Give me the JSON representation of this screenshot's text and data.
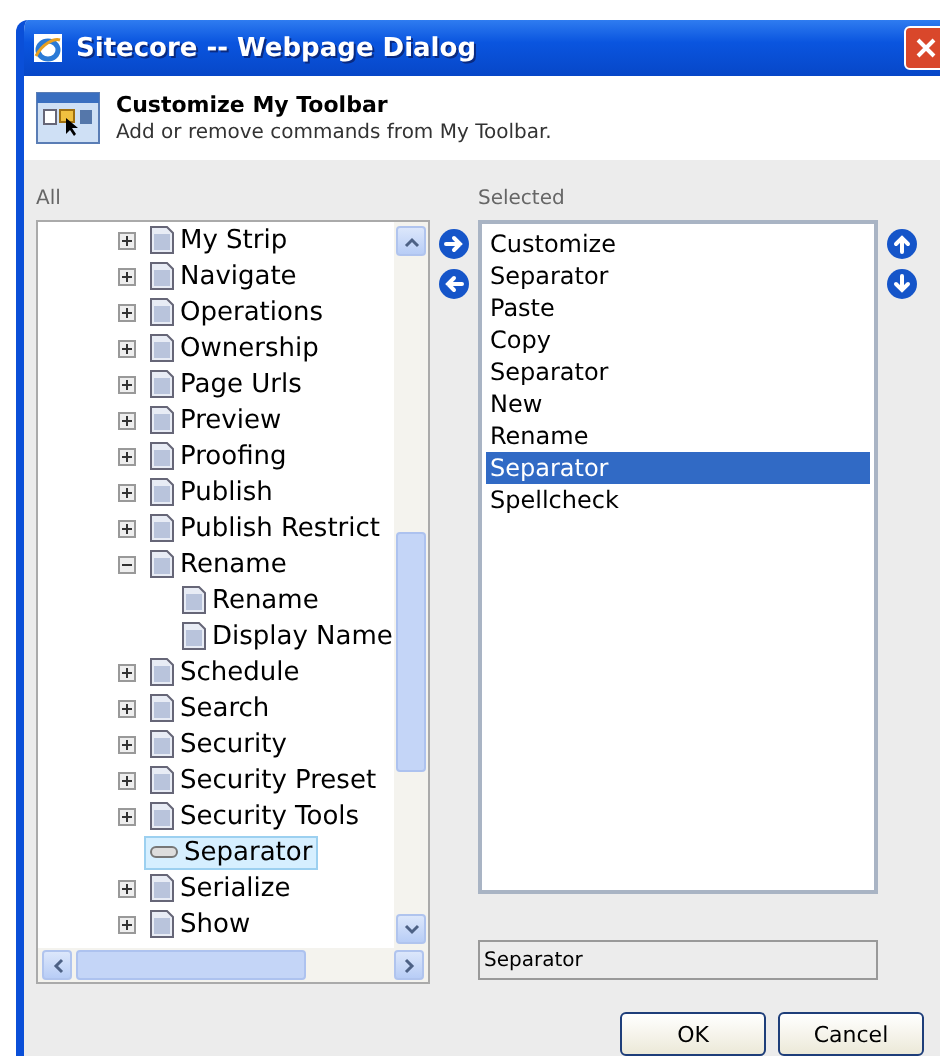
{
  "window": {
    "title": "Sitecore -- Webpage Dialog"
  },
  "header": {
    "title": "Customize My Toolbar",
    "subtitle": "Add or remove commands from My Toolbar."
  },
  "all_label": "All",
  "selected_label": "Selected",
  "tree": [
    {
      "label": "My Strip",
      "kind": "group",
      "expanded": false,
      "selected": false
    },
    {
      "label": "Navigate",
      "kind": "group",
      "expanded": false,
      "selected": false
    },
    {
      "label": "Operations",
      "kind": "group",
      "expanded": false,
      "selected": false
    },
    {
      "label": "Ownership",
      "kind": "group",
      "expanded": false,
      "selected": false
    },
    {
      "label": "Page Urls",
      "kind": "group",
      "expanded": false,
      "selected": false
    },
    {
      "label": "Preview",
      "kind": "group",
      "expanded": false,
      "selected": false
    },
    {
      "label": "Proofing",
      "kind": "group",
      "expanded": false,
      "selected": false
    },
    {
      "label": "Publish",
      "kind": "group",
      "expanded": false,
      "selected": false
    },
    {
      "label": "Publish Restrict",
      "kind": "group",
      "expanded": false,
      "selected": false
    },
    {
      "label": "Rename",
      "kind": "group",
      "expanded": true,
      "selected": false,
      "children": [
        {
          "label": "Rename",
          "kind": "item",
          "selected": false
        },
        {
          "label": "Display Name",
          "kind": "item",
          "selected": false
        }
      ]
    },
    {
      "label": "Schedule",
      "kind": "group",
      "expanded": false,
      "selected": false
    },
    {
      "label": "Search",
      "kind": "group",
      "expanded": false,
      "selected": false
    },
    {
      "label": "Security",
      "kind": "group",
      "expanded": false,
      "selected": false
    },
    {
      "label": "Security Preset",
      "kind": "group",
      "expanded": false,
      "selected": false
    },
    {
      "label": "Security Tools",
      "kind": "group",
      "expanded": false,
      "selected": false
    },
    {
      "label": "Separator",
      "kind": "separator",
      "selected": true
    },
    {
      "label": "Serialize",
      "kind": "group",
      "expanded": false,
      "selected": false
    },
    {
      "label": "Show",
      "kind": "group",
      "expanded": false,
      "selected": false
    }
  ],
  "selected_list": [
    {
      "label": "Customize",
      "selected": false
    },
    {
      "label": "Separator",
      "selected": false
    },
    {
      "label": "Paste",
      "selected": false
    },
    {
      "label": "Copy",
      "selected": false
    },
    {
      "label": "Separator",
      "selected": false
    },
    {
      "label": "New",
      "selected": false
    },
    {
      "label": "Rename",
      "selected": false
    },
    {
      "label": "Separator",
      "selected": true
    },
    {
      "label": "Spellcheck",
      "selected": false
    }
  ],
  "name_field": {
    "value": "Separator"
  },
  "buttons": [
    "OK",
    "Cancel"
  ]
}
